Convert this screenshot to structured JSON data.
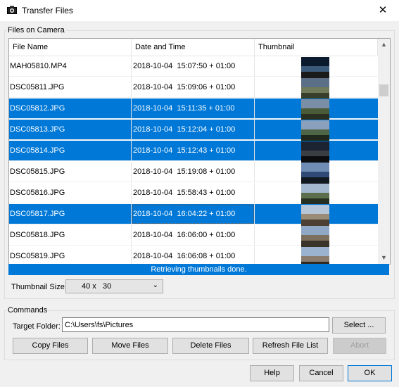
{
  "window": {
    "title": "Transfer Files",
    "close_glyph": "✕"
  },
  "files_group": {
    "legend": "Files on Camera",
    "columns": [
      "File Name",
      "Date and Time",
      "Thumbnail"
    ],
    "rows": [
      {
        "name": "MAH05810.MP4",
        "datetime": "2018-10-04  15:07:50 + 01:00",
        "selected": false
      },
      {
        "name": "DSC05811.JPG",
        "datetime": "2018-10-04  15:09:06 + 01:00",
        "selected": false
      },
      {
        "name": "DSC05812.JPG",
        "datetime": "2018-10-04  15:11:35 + 01:00",
        "selected": true
      },
      {
        "name": "DSC05813.JPG",
        "datetime": "2018-10-04  15:12:04 + 01:00",
        "selected": true
      },
      {
        "name": "DSC05814.JPG",
        "datetime": "2018-10-04  15:12:43 + 01:00",
        "selected": true
      },
      {
        "name": "DSC05815.JPG",
        "datetime": "2018-10-04  15:19:08 + 01:00",
        "selected": false
      },
      {
        "name": "DSC05816.JPG",
        "datetime": "2018-10-04  15:58:43 + 01:00",
        "selected": false
      },
      {
        "name": "DSC05817.JPG",
        "datetime": "2018-10-04  16:04:22 + 01:00",
        "selected": true,
        "focused": true
      },
      {
        "name": "DSC05818.JPG",
        "datetime": "2018-10-04  16:06:00 + 01:00",
        "selected": false
      },
      {
        "name": "DSC05819.JPG",
        "datetime": "2018-10-04  16:06:08 + 01:00",
        "selected": false
      }
    ],
    "status": "Retrieving thumbnails done.",
    "thumbnail_size_label": "Thumbnail Size:",
    "thumbnail_size_value": "40 x   30"
  },
  "commands": {
    "legend": "Commands",
    "target_folder_label": "Target Folder:",
    "target_folder_value": "C:\\Users\\fs\\Pictures",
    "select_label": "Select ...",
    "copy_label": "Copy Files",
    "move_label": "Move Files",
    "delete_label": "Delete Files",
    "refresh_label": "Refresh File List",
    "abort_label": "Abort"
  },
  "footer": {
    "help_label": "Help",
    "cancel_label": "Cancel",
    "ok_label": "OK"
  },
  "colors": {
    "selection": "#0078d7",
    "status_bar": "#0078d7"
  }
}
